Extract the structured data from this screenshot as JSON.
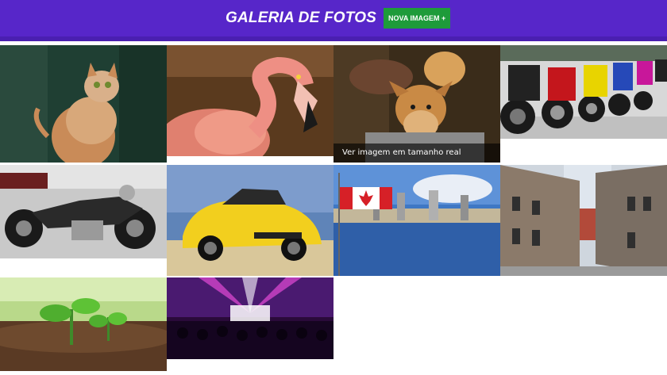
{
  "header": {
    "title": "GALERIA DE FOTOS",
    "new_button_label": "NOVA IMAGEM +"
  },
  "gallery": {
    "hover_caption": "Ver imagem em tamanho real",
    "photos": [
      {
        "subject": "cat"
      },
      {
        "subject": "flamingo"
      },
      {
        "subject": "puppies"
      },
      {
        "subject": "sport-motorcycles"
      },
      {
        "subject": "cruiser-motorcycles"
      },
      {
        "subject": "yellow-mustang"
      },
      {
        "subject": "canada-flag-skyline"
      },
      {
        "subject": "old-quebec-street"
      },
      {
        "subject": "seedling"
      },
      {
        "subject": "concert"
      }
    ]
  },
  "colors": {
    "header_bg": "#5726c9",
    "button_bg": "#1e9b3a"
  }
}
